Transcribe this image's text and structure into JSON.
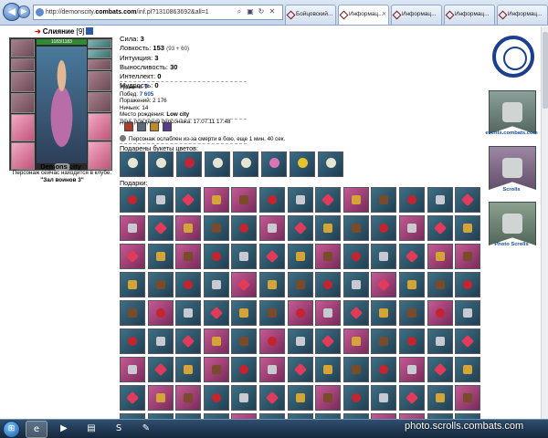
{
  "browser": {
    "url_prefix": "http://demonscity.",
    "url_host": "combats.com",
    "url_path": "/inf.pl?1310863692&all=1",
    "tabs": [
      {
        "label": "Бойцовский..."
      },
      {
        "label": "Информац..."
      },
      {
        "label": "Информац..."
      },
      {
        "label": "Информац..."
      },
      {
        "label": "Информац..."
      }
    ]
  },
  "character": {
    "name": "Слияние",
    "level": "[9]",
    "hp": "1183/1183",
    "city": "Demons city",
    "status": "Персонаж сейчас находится в клубе.",
    "location": "\"Зал воинов 3\""
  },
  "stats": [
    {
      "label": "Сила:",
      "value": "3",
      "extra": ""
    },
    {
      "label": "Ловкость:",
      "value": "153",
      "extra": "(93 + 60)"
    },
    {
      "label": "Интуиция:",
      "value": "3",
      "extra": ""
    },
    {
      "label": "Выносливость:",
      "value": "30",
      "extra": ""
    },
    {
      "label": "Интеллект:",
      "value": "0",
      "extra": ""
    },
    {
      "label": "Мудрость:",
      "value": "0",
      "extra": ""
    }
  ],
  "info": [
    {
      "label": "Уровень:",
      "value": "9"
    },
    {
      "label": "Побед:",
      "value": "7 605"
    },
    {
      "label": "Поражений:",
      "value": "2 176"
    },
    {
      "label": "Ничьих:",
      "value": "14"
    },
    {
      "label": "Место рождения:",
      "value": "Low city"
    },
    {
      "label": "День рождения персонажа:",
      "value": "17.07.11 17:48"
    }
  ],
  "weakness_text": "Персонаж ослаблен из-за смерти в бою, еще 1 мин. 40 сек.",
  "bouquets_title": "Подарены букеты цветов:",
  "gifts_title": "Подарки:",
  "sidebar": {
    "events_label": "events.combats.com",
    "scrolls_label": "Scrolls",
    "photo_label": "Photo Scrolls"
  },
  "watermark": "photo.scrolls.combats.com"
}
